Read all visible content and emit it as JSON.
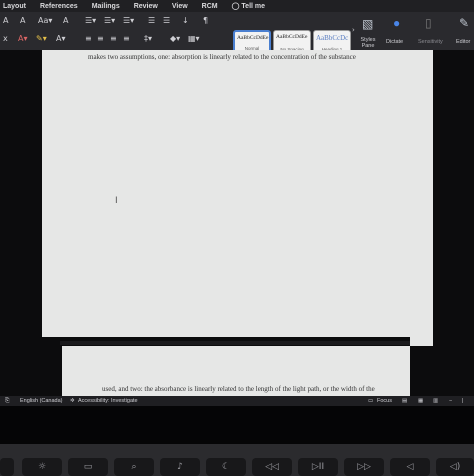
{
  "menubar": {
    "items": [
      "Layout",
      "References",
      "Mailings",
      "Review",
      "View",
      "RCM",
      "Tell me"
    ]
  },
  "ribbon": {
    "styles": [
      {
        "preview": "AaBbCcDdEe",
        "name": "Normal"
      },
      {
        "preview": "AaBbCcDdEe",
        "name": "No Spacing"
      },
      {
        "preview": "AaBbCcDc",
        "name": "Heading 1"
      }
    ],
    "styles_pane_label": "Styles\nPane",
    "dictate_label": "Dictate",
    "sensitivity_label": "Sensitivity",
    "editor_label": "Editor"
  },
  "document": {
    "line1": "makes two assumptions, one: absorption is linearly related to the concentration of the substance",
    "line2": "used, and two: the absorbance is linearly related to the length of the light path, or the width of the"
  },
  "status": {
    "language": "English (Canada)",
    "accessibility": "Accessibility: Investigate",
    "focus": "Focus"
  },
  "colors": {
    "page_bg": "#e6e7e6",
    "ribbon_bg": "#2a2a2e",
    "accent": "#4a7fd0"
  }
}
